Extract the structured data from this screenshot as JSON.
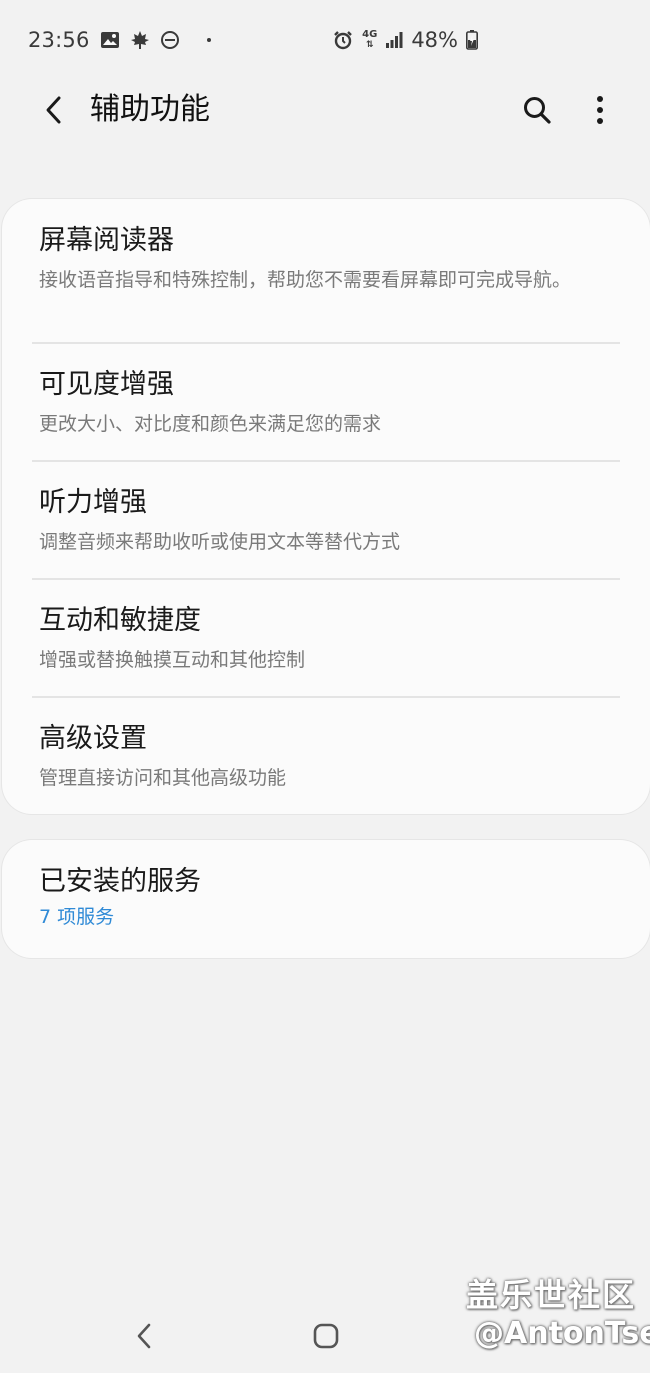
{
  "status_bar": {
    "time": "23:56",
    "network": "4G",
    "battery": "48%",
    "icons": [
      "image-icon",
      "maple-leaf-icon",
      "do-not-disturb-icon",
      "dot-icon",
      "alarm-icon",
      "network-4g-icon",
      "signal-icon",
      "battery-charging-icon"
    ]
  },
  "app_bar": {
    "title": "辅助功能",
    "back_icon": "back-arrow-icon",
    "search_icon": "search-icon",
    "more_icon": "more-vert-icon"
  },
  "menu": {
    "items": [
      {
        "title": "屏幕阅读器",
        "description": "接收语音指导和特殊控制，帮助您不需要看屏幕即可完成导航。"
      },
      {
        "title": "可见度增强",
        "description": "更改大小、对比度和颜色来满足您的需求"
      },
      {
        "title": "听力增强",
        "description": "调整音频来帮助收听或使用文本等替代方式"
      },
      {
        "title": "互动和敏捷度",
        "description": "增强或替换触摸互动和其他控制"
      },
      {
        "title": "高级设置",
        "description": "管理直接访问和其他高级功能"
      }
    ]
  },
  "installed_services": {
    "title": "已安装的服务",
    "subtitle": "7 项服务"
  },
  "watermark": {
    "line1": "盖乐世社区",
    "line2": "@AntonTse"
  },
  "colors": {
    "background": "#f2f2f2",
    "card": "#fbfbfb",
    "accent": "#2f8ad6",
    "secondary_text": "#7a7a7a"
  }
}
